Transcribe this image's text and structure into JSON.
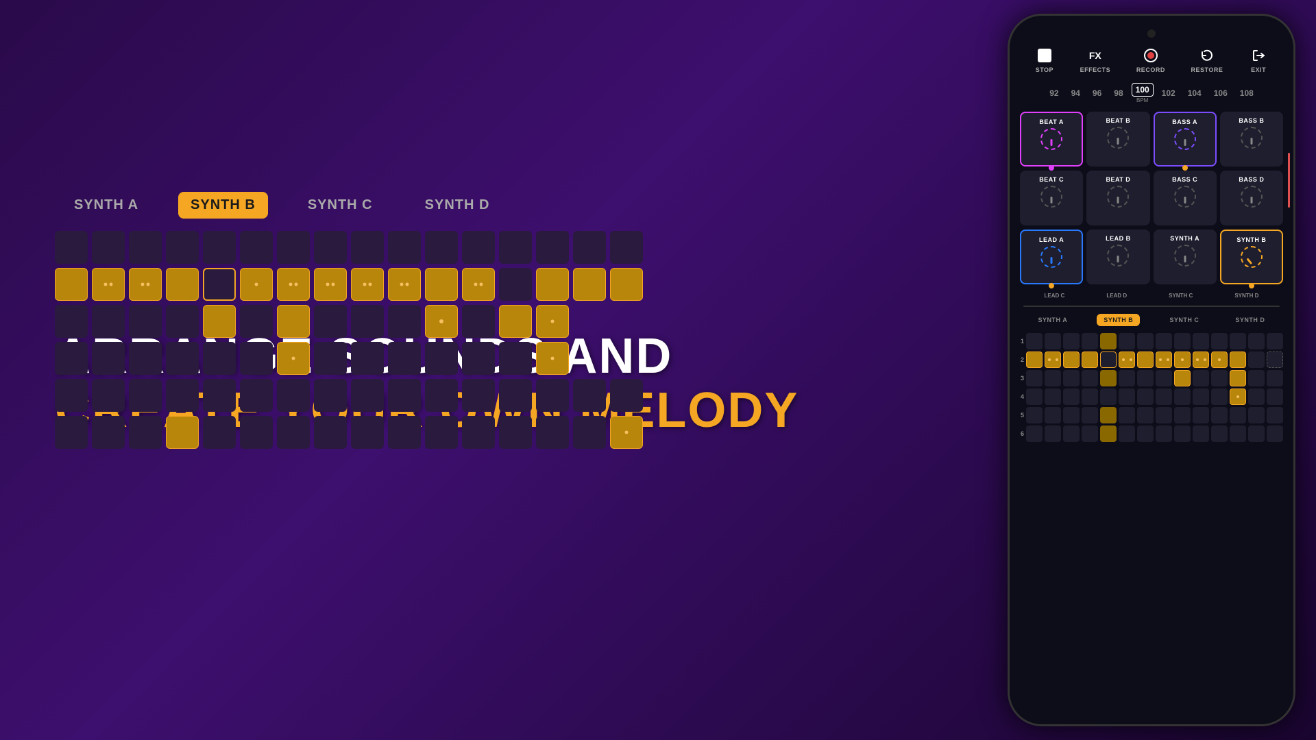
{
  "headline": {
    "line1": "ARRANGE SOUNDS AND",
    "line2": "CREATE YOUR OWN MELODY"
  },
  "tabs": [
    "SYNTH A",
    "SYNTH B",
    "SYNTH C",
    "SYNTH D"
  ],
  "active_tab": "SYNTH B",
  "controls": {
    "stop": "STOP",
    "fx": "FX",
    "effects": "EFFECTS",
    "record": "RECORD",
    "restore": "RESTORE",
    "exit": "EXIT"
  },
  "bpm_values": [
    "92",
    "94",
    "96",
    "98",
    "100",
    "102",
    "104",
    "106",
    "108"
  ],
  "active_bpm": "100",
  "bpm_label": "BPM",
  "pads": [
    {
      "name": "BEAT A",
      "border": "pink",
      "knob": "pink"
    },
    {
      "name": "BEAT B",
      "border": "none",
      "knob": "none"
    },
    {
      "name": "BASS A",
      "border": "purple",
      "knob": "purple"
    },
    {
      "name": "BASS B",
      "border": "none",
      "knob": "none"
    },
    {
      "name": "BEAT C",
      "border": "none",
      "knob": "none"
    },
    {
      "name": "BEAT D",
      "border": "none",
      "knob": "none"
    },
    {
      "name": "BASS C",
      "border": "none",
      "knob": "none"
    },
    {
      "name": "BASS D",
      "border": "none",
      "knob": "none"
    },
    {
      "name": "LEAD A",
      "border": "blue",
      "knob": "blue"
    },
    {
      "name": "LEAD B",
      "border": "none",
      "knob": "none"
    },
    {
      "name": "SYNTH A",
      "border": "none",
      "knob": "none"
    },
    {
      "name": "SYNTH B",
      "border": "orange",
      "knob": "orange"
    },
    {
      "name": "LEAD C",
      "border": "none",
      "knob": "none"
    },
    {
      "name": "LEAD D",
      "border": "none",
      "knob": "none"
    },
    {
      "name": "SYNTH C",
      "border": "none",
      "knob": "none"
    },
    {
      "name": "SYNTH D",
      "border": "none",
      "knob": "none"
    }
  ],
  "phone_tabs": [
    "SYNTH A",
    "SYNTH B",
    "SYNTH C",
    "SYNTH D"
  ],
  "phone_active_tab": "SYNTH B"
}
